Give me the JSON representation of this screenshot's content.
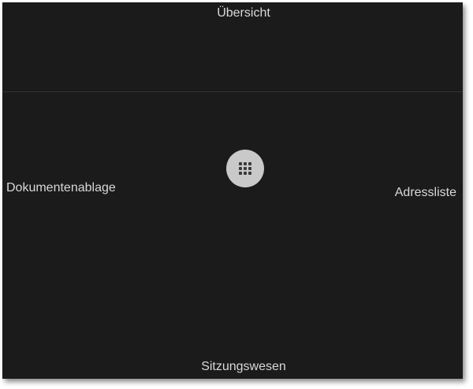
{
  "navigation": {
    "top_label": "Übersicht",
    "left_label": "Dokumentenablage",
    "right_label": "Adressliste",
    "bottom_label": "Sitzungswesen"
  },
  "hub": {
    "icon": "grid-icon"
  },
  "colors": {
    "background": "#1b1b1b",
    "text": "#d9d9d9",
    "hub_button": "#c9c9c9",
    "hub_icon": "#3a3a3a"
  }
}
